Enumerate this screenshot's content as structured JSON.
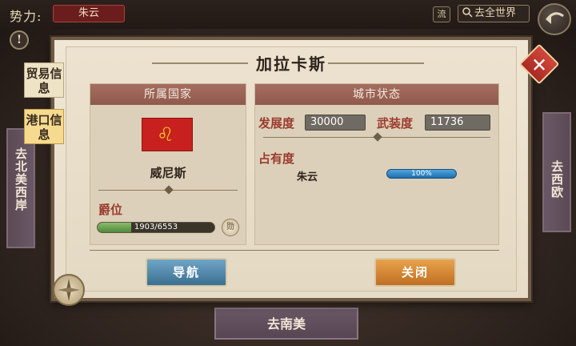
{
  "top_bar": {
    "faction_label": "势力:",
    "faction_name": "朱云",
    "flow_label": "流",
    "world_button": "去全世界"
  },
  "side_nav": {
    "left": "去北美西岸",
    "right": "去西欧",
    "bottom": "去南美"
  },
  "dialog": {
    "title": "加拉卡斯",
    "tabs": [
      "贸易信息",
      "港口信息"
    ],
    "country_panel": {
      "header": "所属国家",
      "country": "威尼斯",
      "rank_label": "爵位",
      "rank_progress": "1903/6553",
      "rank_fraction": 0.29,
      "rank_button": "勋"
    },
    "city_panel": {
      "header": "城市状态",
      "development_label": "发展度",
      "development_value": "30000",
      "armament_label": "武装度",
      "armament_value": "11736",
      "occupancy_label": "占有度",
      "owner": "朱云",
      "owner_share": "100%"
    },
    "navigate_button": "导航",
    "close_button": "关闭"
  },
  "colors": {
    "accent_red": "#a46d5f",
    "nav_blue": "#3b6f92",
    "close_orange": "#c06f22"
  }
}
